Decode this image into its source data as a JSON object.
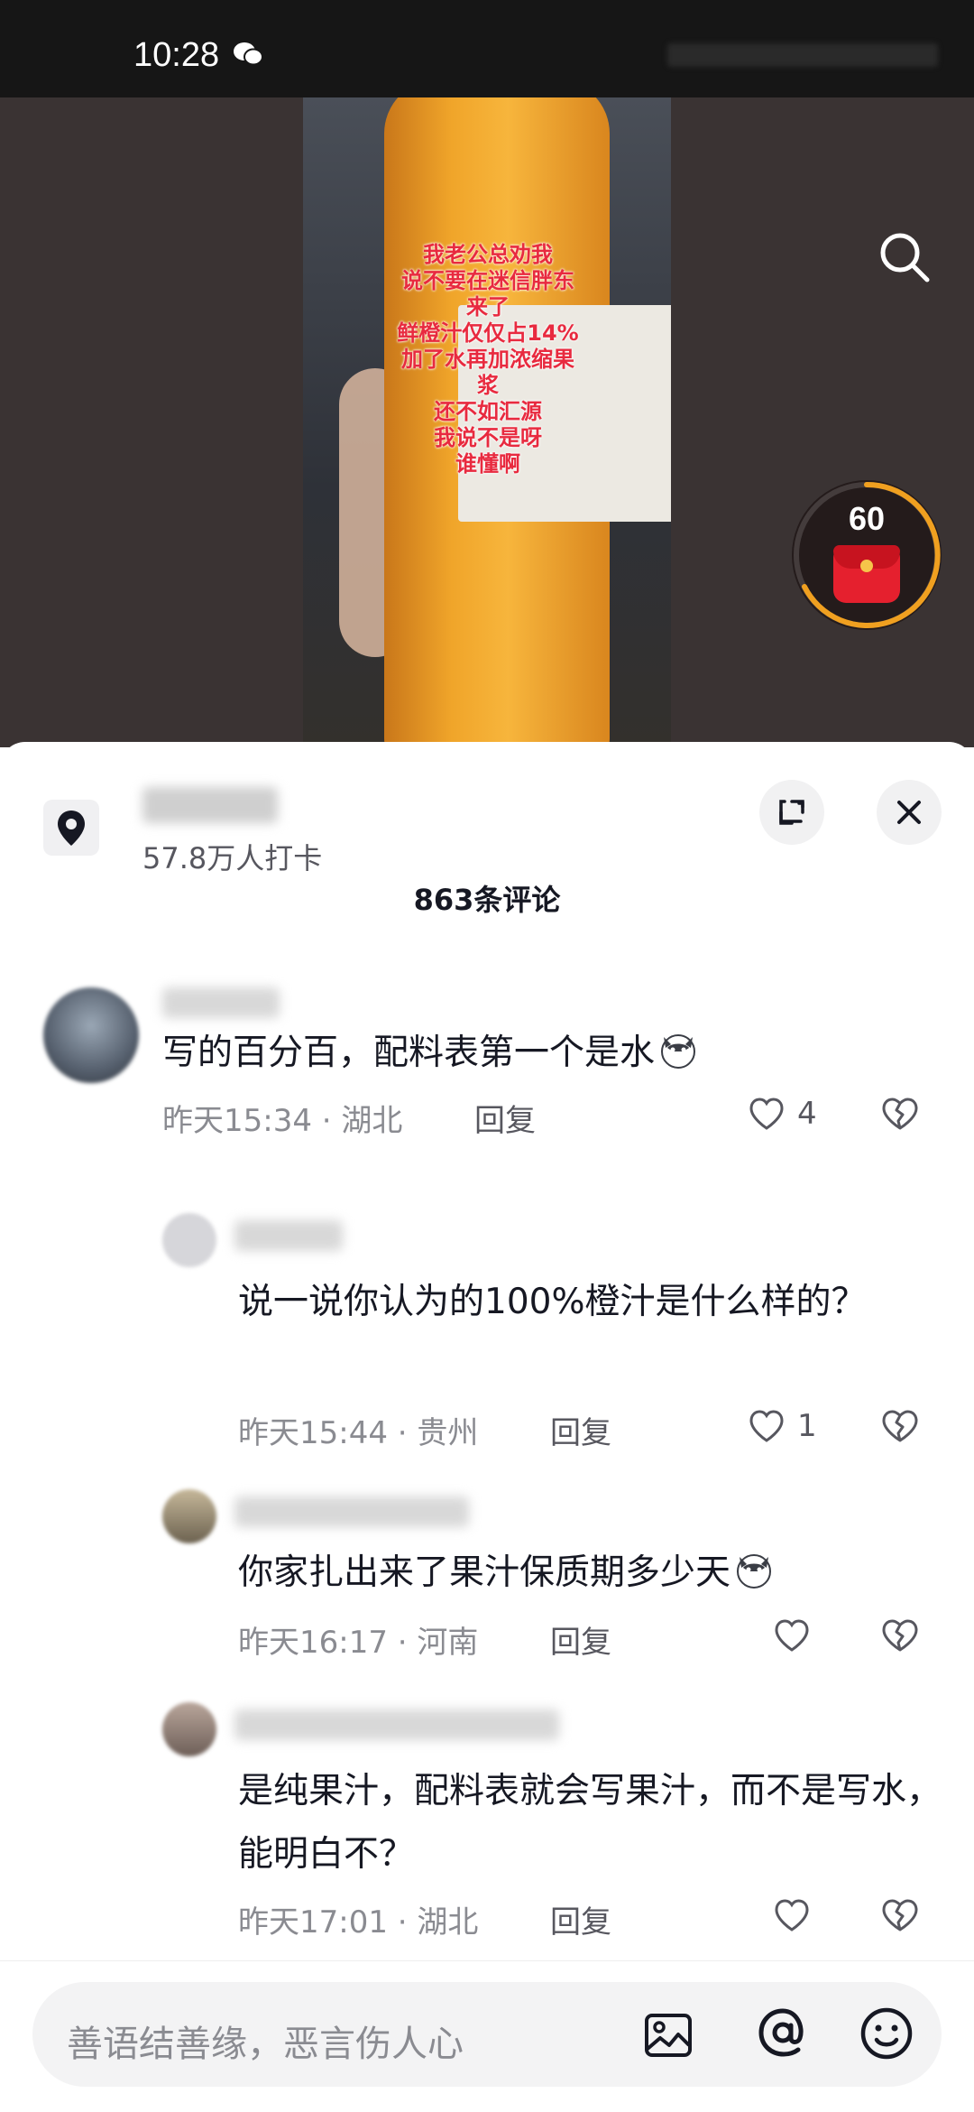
{
  "status_bar": {
    "time": "10:28"
  },
  "video": {
    "overlay_lines": [
      "我老公总劝我",
      "说不要在迷信胖东",
      "来了",
      "鲜橙汁仅仅占14%",
      "加了水再加浓缩果",
      "浆",
      "还不如汇源",
      "我说不是呀",
      "谁懂啊"
    ],
    "red_packet_count": "60"
  },
  "location": {
    "count_text": "57.8万人打卡"
  },
  "comments_header": {
    "title": "863条评论"
  },
  "comments": [
    {
      "text": "写的百分百，配料表第一个是水",
      "time_location": "昨天15:34 · 湖北",
      "reply": "回复",
      "likes": "4"
    },
    {
      "text": "说一说你认为的100%橙汁是什么样的？",
      "time_location": "昨天15:44 · 贵州",
      "reply": "回复",
      "likes": "1"
    },
    {
      "text": "你家扎出来了果汁保质期多少天",
      "time_location": "昨天16:17 · 河南",
      "reply": "回复",
      "likes": ""
    },
    {
      "text": "是纯果汁，配料表就会写果汁，而不是写水，能明白不？",
      "time_location": "昨天17:01 · 湖北",
      "reply": "回复",
      "likes": ""
    }
  ],
  "input": {
    "placeholder": "善语结善缘，恶言伤人心"
  },
  "colors": {
    "overlay_text": "#e82a3f",
    "red_packet": "#e5202e",
    "ring": "#f0a020"
  }
}
